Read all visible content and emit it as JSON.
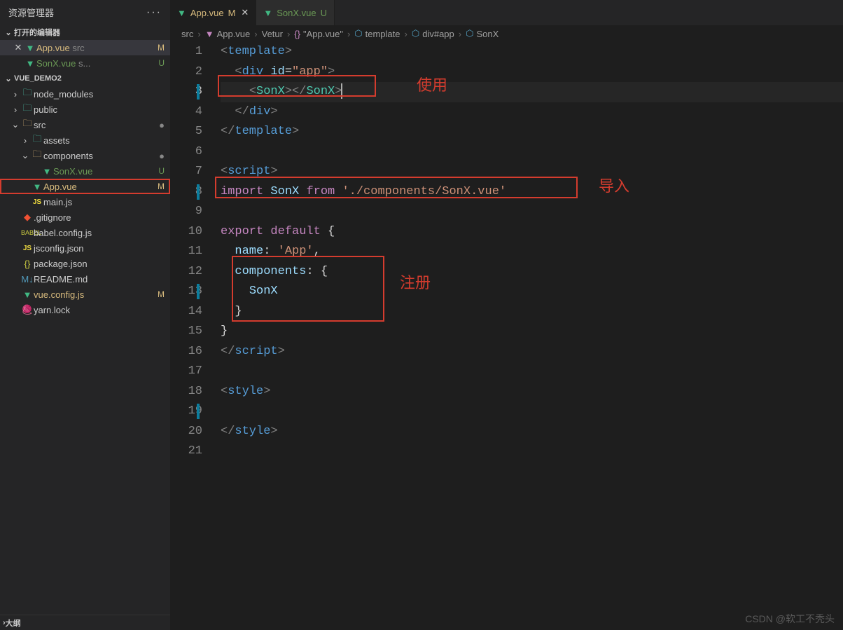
{
  "sidebar": {
    "title": "资源管理器",
    "open_editors_label": "打开的编辑器",
    "open_editors": [
      {
        "name": "App.vue",
        "path": "src",
        "status": "M",
        "icon": "vue",
        "active": true
      },
      {
        "name": "SonX.vue",
        "path": "s...",
        "status": "U",
        "icon": "vue",
        "active": false
      }
    ],
    "project_name": "VUE_DEMO2",
    "tree": [
      {
        "depth": 0,
        "chev": "›",
        "icon": "folder-green",
        "label": "node_modules"
      },
      {
        "depth": 0,
        "chev": "›",
        "icon": "folder-green",
        "label": "public"
      },
      {
        "depth": 0,
        "chev": "⌄",
        "icon": "folder",
        "label": "src",
        "dot": true
      },
      {
        "depth": 1,
        "chev": "›",
        "icon": "folder-green",
        "label": "assets"
      },
      {
        "depth": 1,
        "chev": "⌄",
        "icon": "folder",
        "label": "components",
        "dot": true
      },
      {
        "depth": 2,
        "chev": "",
        "icon": "vue",
        "label": "SonX.vue",
        "status": "U",
        "cls": "add"
      },
      {
        "depth": 1,
        "chev": "",
        "icon": "vue",
        "label": "App.vue",
        "status": "M",
        "cls": "mod",
        "selected": true
      },
      {
        "depth": 1,
        "chev": "",
        "icon": "js",
        "label": "main.js"
      },
      {
        "depth": 0,
        "chev": "",
        "icon": "git",
        "label": ".gitignore"
      },
      {
        "depth": 0,
        "chev": "",
        "icon": "babel",
        "label": "babel.config.js"
      },
      {
        "depth": 0,
        "chev": "",
        "icon": "js",
        "label": "jsconfig.json"
      },
      {
        "depth": 0,
        "chev": "",
        "icon": "json",
        "label": "package.json"
      },
      {
        "depth": 0,
        "chev": "",
        "icon": "md",
        "label": "README.md"
      },
      {
        "depth": 0,
        "chev": "",
        "icon": "vue",
        "label": "vue.config.js",
        "status": "M",
        "cls": "mod"
      },
      {
        "depth": 0,
        "chev": "",
        "icon": "yarn",
        "label": "yarn.lock"
      }
    ],
    "outline_label": "大纲"
  },
  "tabs": [
    {
      "icon": "vue",
      "name": "App.vue",
      "status": "M",
      "active": true,
      "color": "mod"
    },
    {
      "icon": "vue",
      "name": "SonX.vue",
      "status": "U",
      "active": false,
      "color": "add"
    }
  ],
  "breadcrumbs": {
    "items": [
      "src",
      "App.vue",
      "Vetur",
      "\"App.vue\"",
      "template",
      "div#app",
      "SonX"
    ]
  },
  "editor": {
    "lines": [
      {
        "n": 1,
        "mod": false,
        "html": "<span class='t-punc'>&lt;</span><span class='t-tag'>template</span><span class='t-punc'>&gt;</span>"
      },
      {
        "n": 2,
        "mod": false,
        "html": "<span class='indent-guide'>  </span><span class='t-punc'>&lt;</span><span class='t-tag'>div</span> <span class='t-attr'>id</span><span class='t-white'>=</span><span class='t-str'>\"app\"</span><span class='t-punc'>&gt;</span>"
      },
      {
        "n": 3,
        "mod": true,
        "current": true,
        "html": "<span class='indent-guide'>  </span><span class='indent-guide'>  </span><span class='t-punc'>&lt;</span><span class='t-comp'>SonX</span><span class='t-punc'>&gt;</span><span class='t-punc'>&lt;/</span><span class='t-comp'>SonX</span><span class='t-punc'>&gt;</span><span class='cursor'></span>"
      },
      {
        "n": 4,
        "mod": false,
        "html": "<span class='indent-guide'>  </span><span class='t-punc'>&lt;/</span><span class='t-tag'>div</span><span class='t-punc'>&gt;</span>"
      },
      {
        "n": 5,
        "mod": false,
        "html": "<span class='t-punc'>&lt;/</span><span class='t-tag'>template</span><span class='t-punc'>&gt;</span>"
      },
      {
        "n": 6,
        "mod": false,
        "html": ""
      },
      {
        "n": 7,
        "mod": false,
        "html": "<span class='t-punc'>&lt;</span><span class='t-tag'>script</span><span class='t-punc'>&gt;</span>"
      },
      {
        "n": 8,
        "mod": true,
        "html": "<span class='t-kw'>import</span> <span class='t-id'>SonX</span> <span class='t-kw'>from</span> <span class='t-str'>'./components/SonX.vue'</span>"
      },
      {
        "n": 9,
        "mod": false,
        "html": ""
      },
      {
        "n": 10,
        "mod": false,
        "html": "<span class='t-kw'>export</span> <span class='t-kw'>default</span> <span class='t-white'>{</span>"
      },
      {
        "n": 11,
        "mod": false,
        "html": "<span class='indent-guide'>  </span><span class='t-id'>name</span><span class='t-white'>:</span> <span class='t-str'>'App'</span><span class='t-white'>,</span>"
      },
      {
        "n": 12,
        "mod": false,
        "html": "<span class='indent-guide'>  </span><span class='t-id'>components</span><span class='t-white'>:</span> <span class='t-white'>{</span>"
      },
      {
        "n": 13,
        "mod": true,
        "html": "<span class='indent-guide'>  </span><span class='indent-guide'>  </span><span class='t-id'>SonX</span>"
      },
      {
        "n": 14,
        "mod": false,
        "html": "<span class='indent-guide'>  </span><span class='t-white'>}</span>"
      },
      {
        "n": 15,
        "mod": false,
        "html": "<span class='t-white'>}</span>"
      },
      {
        "n": 16,
        "mod": false,
        "html": "<span class='t-punc'>&lt;/</span><span class='t-tag'>script</span><span class='t-punc'>&gt;</span>"
      },
      {
        "n": 17,
        "mod": false,
        "html": ""
      },
      {
        "n": 18,
        "mod": false,
        "html": "<span class='t-punc'>&lt;</span><span class='t-tag'>style</span><span class='t-punc'>&gt;</span>"
      },
      {
        "n": 19,
        "mod": true,
        "html": ""
      },
      {
        "n": 20,
        "mod": false,
        "html": "<span class='t-punc'>&lt;/</span><span class='t-tag'>style</span><span class='t-punc'>&gt;</span>"
      },
      {
        "n": 21,
        "mod": false,
        "html": ""
      }
    ]
  },
  "annotations": {
    "use": "使用",
    "import": "导入",
    "register": "注册"
  },
  "watermark": "CSDN @软工不秃头"
}
